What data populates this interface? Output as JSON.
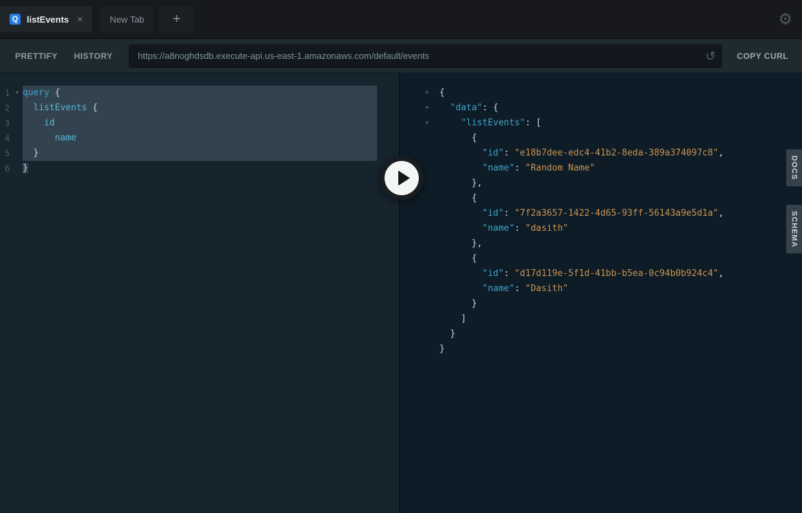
{
  "icons": {
    "gear": "⚙",
    "close": "×",
    "plus": "+",
    "fold_caret": "▾",
    "reload": "↺",
    "tab_badge": "Q",
    "play": "▶"
  },
  "tabs": {
    "active": {
      "label": "listEvents"
    },
    "new_tab": {
      "label": "New Tab"
    }
  },
  "toolbar": {
    "prettify": "PRETTIFY",
    "history": "HISTORY",
    "url": "https://a8noghdsdb.execute-api.us-east-1.amazonaws.com/default/events",
    "copy_curl": "COPY CURL"
  },
  "side_tabs": {
    "docs": "DOCS",
    "schema": "SCHEMA"
  },
  "editor": {
    "lines": [
      {
        "num": "1",
        "fold": true,
        "sel": "full",
        "tokens": [
          {
            "t": "query",
            "c": "kw"
          },
          {
            "t": " ",
            "c": "pl"
          },
          {
            "t": "{",
            "c": "pu"
          }
        ]
      },
      {
        "num": "2",
        "fold": false,
        "sel": "full",
        "tokens": [
          {
            "t": "  ",
            "c": "pl"
          },
          {
            "t": "listEvents",
            "c": "fd"
          },
          {
            "t": " ",
            "c": "pl"
          },
          {
            "t": "{",
            "c": "pu"
          }
        ]
      },
      {
        "num": "3",
        "fold": false,
        "sel": "full",
        "tokens": [
          {
            "t": "    ",
            "c": "pl"
          },
          {
            "t": "id",
            "c": "fd"
          }
        ]
      },
      {
        "num": "4",
        "fold": false,
        "sel": "full",
        "tokens": [
          {
            "t": "      ",
            "c": "pl"
          },
          {
            "t": "name",
            "c": "fd"
          }
        ]
      },
      {
        "num": "5",
        "fold": false,
        "sel": "full",
        "tokens": [
          {
            "t": "  ",
            "c": "pl"
          },
          {
            "t": "}",
            "c": "pu"
          }
        ]
      },
      {
        "num": "6",
        "fold": false,
        "sel": "char",
        "tokens": [
          {
            "t": "}",
            "c": "pu"
          }
        ]
      }
    ]
  },
  "response": {
    "events": [
      {
        "id": "e18b7dee-edc4-41b2-8eda-389a374097c8",
        "name": "Random Name"
      },
      {
        "id": "7f2a3657-1422-4d65-93ff-56143a9e5d1a",
        "name": "dasith"
      },
      {
        "id": "d17d119e-5f1d-41bb-b5ea-0c94b0b924c4",
        "name": "Dasith"
      }
    ],
    "lines": [
      {
        "fold": true,
        "tokens": [
          {
            "t": "{",
            "c": "pu"
          }
        ]
      },
      {
        "fold": true,
        "tokens": [
          {
            "t": "  ",
            "c": "pl"
          },
          {
            "t": "\"data\"",
            "c": "key"
          },
          {
            "t": ": {",
            "c": "pu"
          }
        ]
      },
      {
        "fold": true,
        "tokens": [
          {
            "t": "    ",
            "c": "pl"
          },
          {
            "t": "\"listEvents\"",
            "c": "key"
          },
          {
            "t": ": [",
            "c": "pu"
          }
        ]
      },
      {
        "fold": false,
        "tokens": [
          {
            "t": "      ",
            "c": "pl"
          },
          {
            "t": "{",
            "c": "pu"
          }
        ]
      },
      {
        "fold": false,
        "tokens": [
          {
            "t": "        ",
            "c": "pl"
          },
          {
            "t": "\"id\"",
            "c": "key"
          },
          {
            "t": ": ",
            "c": "pu"
          },
          {
            "t": "\"e18b7dee-edc4-41b2-8eda-389a374097c8\"",
            "c": "str"
          },
          {
            "t": ",",
            "c": "pu"
          }
        ]
      },
      {
        "fold": false,
        "tokens": [
          {
            "t": "        ",
            "c": "pl"
          },
          {
            "t": "\"name\"",
            "c": "key"
          },
          {
            "t": ": ",
            "c": "pu"
          },
          {
            "t": "\"Random Name\"",
            "c": "str"
          }
        ]
      },
      {
        "fold": false,
        "tokens": [
          {
            "t": "      ",
            "c": "pl"
          },
          {
            "t": "},",
            "c": "pu"
          }
        ]
      },
      {
        "fold": false,
        "tokens": [
          {
            "t": "      ",
            "c": "pl"
          },
          {
            "t": "{",
            "c": "pu"
          }
        ]
      },
      {
        "fold": false,
        "tokens": [
          {
            "t": "        ",
            "c": "pl"
          },
          {
            "t": "\"id\"",
            "c": "key"
          },
          {
            "t": ": ",
            "c": "pu"
          },
          {
            "t": "\"7f2a3657-1422-4d65-93ff-56143a9e5d1a\"",
            "c": "str"
          },
          {
            "t": ",",
            "c": "pu"
          }
        ]
      },
      {
        "fold": false,
        "tokens": [
          {
            "t": "        ",
            "c": "pl"
          },
          {
            "t": "\"name\"",
            "c": "key"
          },
          {
            "t": ": ",
            "c": "pu"
          },
          {
            "t": "\"dasith\"",
            "c": "str"
          }
        ]
      },
      {
        "fold": false,
        "tokens": [
          {
            "t": "      ",
            "c": "pl"
          },
          {
            "t": "},",
            "c": "pu"
          }
        ]
      },
      {
        "fold": false,
        "tokens": [
          {
            "t": "      ",
            "c": "pl"
          },
          {
            "t": "{",
            "c": "pu"
          }
        ]
      },
      {
        "fold": false,
        "tokens": [
          {
            "t": "        ",
            "c": "pl"
          },
          {
            "t": "\"id\"",
            "c": "key"
          },
          {
            "t": ": ",
            "c": "pu"
          },
          {
            "t": "\"d17d119e-5f1d-41bb-b5ea-0c94b0b924c4\"",
            "c": "str"
          },
          {
            "t": ",",
            "c": "pu"
          }
        ]
      },
      {
        "fold": false,
        "tokens": [
          {
            "t": "        ",
            "c": "pl"
          },
          {
            "t": "\"name\"",
            "c": "key"
          },
          {
            "t": ": ",
            "c": "pu"
          },
          {
            "t": "\"Dasith\"",
            "c": "str"
          }
        ]
      },
      {
        "fold": false,
        "tokens": [
          {
            "t": "      ",
            "c": "pl"
          },
          {
            "t": "}",
            "c": "pu"
          }
        ]
      },
      {
        "fold": false,
        "tokens": [
          {
            "t": "    ",
            "c": "pl"
          },
          {
            "t": "]",
            "c": "pu"
          }
        ]
      },
      {
        "fold": false,
        "tokens": [
          {
            "t": "  ",
            "c": "pl"
          },
          {
            "t": "}",
            "c": "pu"
          }
        ]
      },
      {
        "fold": false,
        "tokens": [
          {
            "t": "}",
            "c": "pu"
          }
        ]
      }
    ]
  }
}
